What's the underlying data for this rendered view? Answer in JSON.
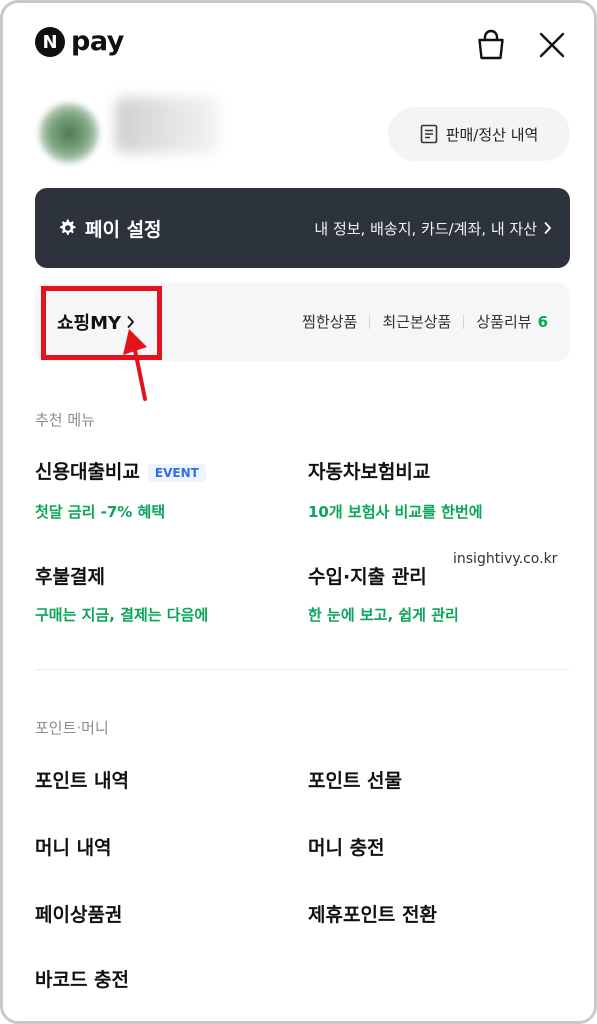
{
  "header": {
    "logo_letter": "N",
    "logo_text": "pay",
    "cart_icon": "shopping-bag-icon",
    "close_icon": "close-icon"
  },
  "profile": {
    "sales_button": "판매/정산 내역"
  },
  "pay_settings": {
    "title": "페이 설정",
    "description": "내 정보, 배송지, 카드/계좌, 내 자산"
  },
  "shopping": {
    "title": "쇼핑MY",
    "links": [
      {
        "label": "찜한상품"
      },
      {
        "label": "최근본상품"
      },
      {
        "label": "상품리뷰",
        "count": "6"
      }
    ]
  },
  "recommended": {
    "label": "추천 메뉴",
    "items": [
      {
        "title": "신용대출비교",
        "badge": "EVENT",
        "subtitle": "첫달 금리 -7% 혜택"
      },
      {
        "title": "자동차보험비교",
        "subtitle": "10개 보험사 비교를 한번에"
      },
      {
        "title": "후불결제",
        "subtitle": "구매는 지금, 결제는 다음에"
      },
      {
        "title": "수입·지출 관리",
        "subtitle": "한 눈에 보고, 쉽게 관리"
      }
    ]
  },
  "watermark": "insightivy.co.kr",
  "points": {
    "label": "포인트·머니",
    "items": [
      {
        "title": "포인트 내역"
      },
      {
        "title": "포인트 선물"
      },
      {
        "title": "머니 내역"
      },
      {
        "title": "머니 충전"
      },
      {
        "title": "페이상품권"
      },
      {
        "title": "제휴포인트 전환"
      },
      {
        "title": "바코드 충전"
      }
    ]
  },
  "colors": {
    "accent_green": "#0aa55a",
    "dark_bar": "#2c333d",
    "highlight_red": "#e5121c",
    "badge_blue": "#2f6ee8"
  }
}
